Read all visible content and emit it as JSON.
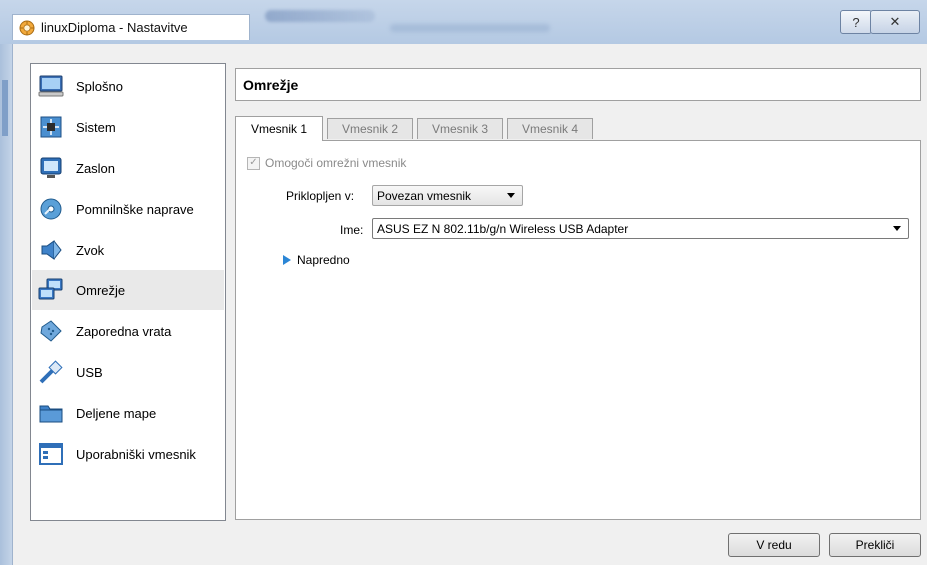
{
  "window": {
    "title": "linuxDiploma - Nastavitve",
    "help_glyph": "?",
    "close_glyph": "✕"
  },
  "sidebar": {
    "items": [
      {
        "label": "Splošno",
        "icon": "monitor-icon"
      },
      {
        "label": "Sistem",
        "icon": "chip-icon"
      },
      {
        "label": "Zaslon",
        "icon": "display-icon"
      },
      {
        "label": "Pomnilnške naprave",
        "icon": "disk-icon"
      },
      {
        "label": "Zvok",
        "icon": "speaker-icon"
      },
      {
        "label": "Omrežje",
        "icon": "network-icon"
      },
      {
        "label": "Zaporedna vrata",
        "icon": "serial-port-icon"
      },
      {
        "label": "USB",
        "icon": "usb-icon"
      },
      {
        "label": "Deljene mape",
        "icon": "folder-icon"
      },
      {
        "label": "Uporabniški vmesnik",
        "icon": "ui-window-icon"
      }
    ],
    "selected": "Omrežje"
  },
  "main": {
    "header": "Omrežje",
    "tabs": [
      {
        "label": "Vmesnik 1"
      },
      {
        "label": "Vmesnik 2"
      },
      {
        "label": "Vmesnik 3"
      },
      {
        "label": "Vmesnik 4"
      }
    ],
    "enable_label": "Omogoči omrežni vmesnik",
    "enable_checked": true,
    "attached_label": "Priklopljen v:",
    "attached_value": "Povezan vmesnik",
    "name_label": "Ime:",
    "name_value": "ASUS EZ N 802.11b/g/n Wireless USB Adapter",
    "advanced_label": "Napredno"
  },
  "footer": {
    "ok_label": "V redu",
    "cancel_label": "Prekliči"
  },
  "colors": {
    "titlebar": "#b4c9e3",
    "selected_item": "#e9e9e9",
    "accent_triangle": "#2b86d6"
  }
}
